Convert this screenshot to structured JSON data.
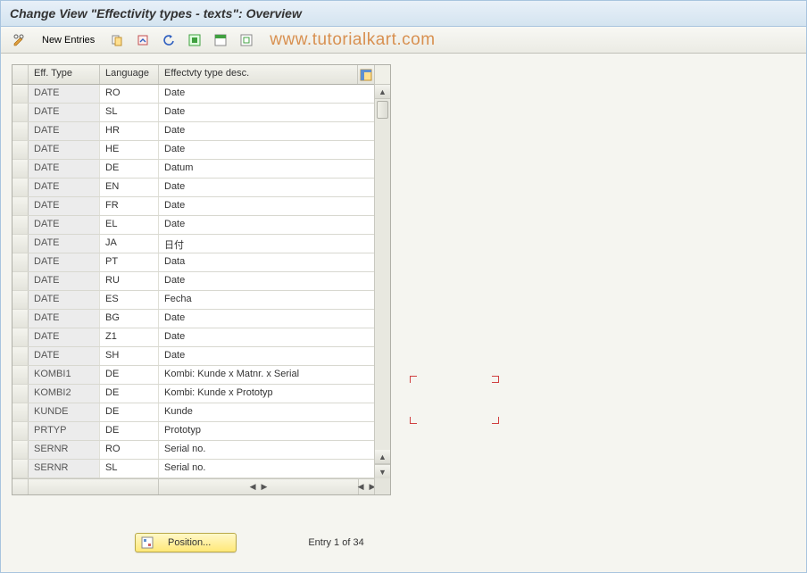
{
  "title": "Change View \"Effectivity types - texts\": Overview",
  "toolbar": {
    "new_entries_label": "New Entries"
  },
  "watermark": "www.tutorialkart.com",
  "table": {
    "columns": [
      "Eff. Type",
      "Language",
      "Effectvty type desc."
    ],
    "rows": [
      {
        "type": "DATE",
        "lang": "RO",
        "desc": "Date"
      },
      {
        "type": "DATE",
        "lang": "SL",
        "desc": "Date"
      },
      {
        "type": "DATE",
        "lang": "HR",
        "desc": "Date"
      },
      {
        "type": "DATE",
        "lang": "HE",
        "desc": "Date"
      },
      {
        "type": "DATE",
        "lang": "DE",
        "desc": "Datum"
      },
      {
        "type": "DATE",
        "lang": "EN",
        "desc": "Date"
      },
      {
        "type": "DATE",
        "lang": "FR",
        "desc": "Date"
      },
      {
        "type": "DATE",
        "lang": "EL",
        "desc": "Date"
      },
      {
        "type": "DATE",
        "lang": "JA",
        "desc": "日付"
      },
      {
        "type": "DATE",
        "lang": "PT",
        "desc": "Data"
      },
      {
        "type": "DATE",
        "lang": "RU",
        "desc": "Date"
      },
      {
        "type": "DATE",
        "lang": "ES",
        "desc": "Fecha"
      },
      {
        "type": "DATE",
        "lang": "BG",
        "desc": "Date"
      },
      {
        "type": "DATE",
        "lang": "Z1",
        "desc": "Date"
      },
      {
        "type": "DATE",
        "lang": "SH",
        "desc": "Date"
      },
      {
        "type": "KOMBI1",
        "lang": "DE",
        "desc": "Kombi: Kunde x Matnr. x Serial"
      },
      {
        "type": "KOMBI2",
        "lang": "DE",
        "desc": "Kombi:   Kunde x Prototyp"
      },
      {
        "type": "KUNDE",
        "lang": "DE",
        "desc": "Kunde"
      },
      {
        "type": "PRTYP",
        "lang": "DE",
        "desc": "Prototyp"
      },
      {
        "type": "SERNR",
        "lang": "RO",
        "desc": "Serial no."
      },
      {
        "type": "SERNR",
        "lang": "SL",
        "desc": "Serial no."
      }
    ]
  },
  "footer": {
    "position_label": "Position...",
    "entry_text": "Entry 1 of 34"
  }
}
